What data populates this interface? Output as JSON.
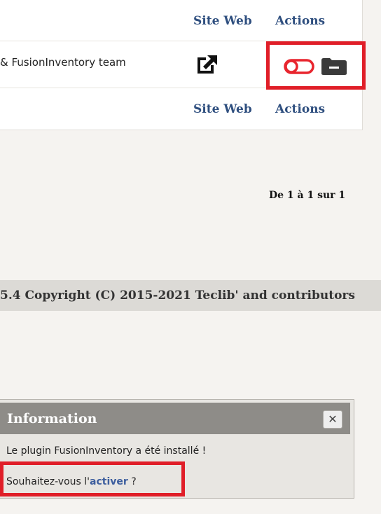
{
  "table": {
    "header": {
      "site_web": "Site Web",
      "actions": "Actions"
    },
    "row": {
      "author": "& FusionInventory team",
      "site_icon": "external-link-icon",
      "action_icons": [
        "toggle-off-icon",
        "folder-minus-icon"
      ]
    },
    "footer": {
      "site_web": "Site Web",
      "actions": "Actions"
    }
  },
  "pager": {
    "text": "De 1 à 1 sur 1"
  },
  "page_footer": {
    "text": "5.4 Copyright (C) 2015-2021 Teclib' and contributors"
  },
  "dialog": {
    "title": "Information",
    "close_icon": "close-icon",
    "message_installed": "Le plugin FusionInventory a été installé !",
    "message_prefix": "Souhaitez-vous l'",
    "activate_link": "activer",
    "message_suffix": " ?"
  },
  "colors": {
    "accent_red": "#e01e28",
    "link_blue": "#3d5e9e",
    "header_blue": "#2f4f7f"
  }
}
